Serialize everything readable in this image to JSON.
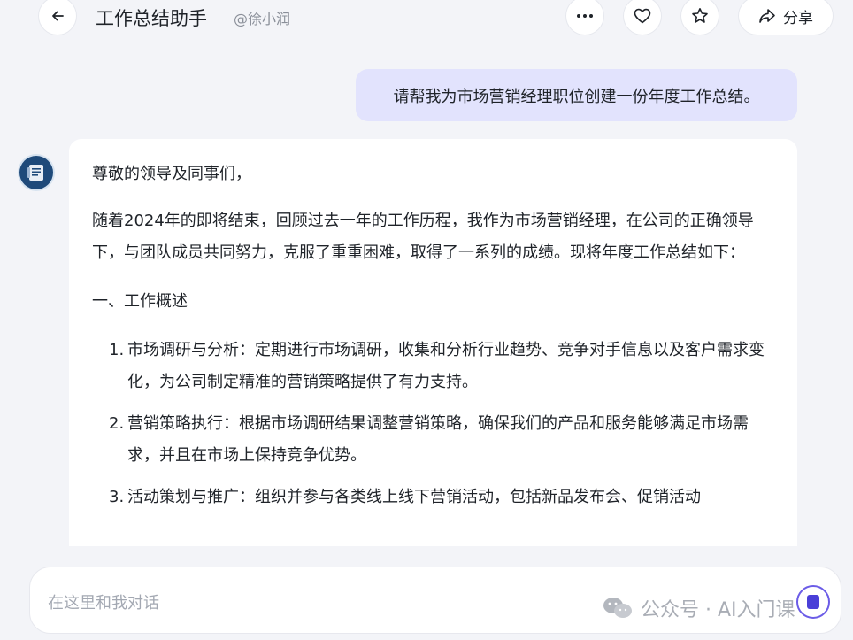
{
  "header": {
    "title": "工作总结助手",
    "author": "@徐小润",
    "share_label": "分享"
  },
  "user_message": "请帮我为市场营销经理职位创建一份年度工作总结。",
  "bot_message": {
    "greeting": "尊敬的领导及同事们，",
    "intro": "随着2024年的即将结束，回顾过去一年的工作历程，我作为市场营销经理，在公司的正确领导下，与团队成员共同努力，克服了重重困难，取得了一系列的成绩。现将年度工作总结如下：",
    "section_title": "一、工作概述",
    "items": [
      {
        "num": "1.",
        "text": "市场调研与分析：定期进行市场调研，收集和分析行业趋势、竞争对手信息以及客户需求变化，为公司制定精准的营销策略提供了有力支持。"
      },
      {
        "num": "2.",
        "text": "营销策略执行：根据市场调研结果调整营销策略，确保我们的产品和服务能够满足市场需求，并且在市场上保持竞争优势。"
      },
      {
        "num": "3.",
        "text": "活动策划与推广：组织并参与各类线上线下营销活动，包括新品发布会、促销活动"
      }
    ]
  },
  "input": {
    "placeholder": "在这里和我对话"
  },
  "watermark": "公众号 · AI入门课",
  "colors": {
    "background": "#f3f4f8",
    "user_bubble": "#e2e3fd",
    "accent": "#4a3fd8"
  },
  "icons": [
    "back-arrow-icon",
    "more-icon",
    "heart-icon",
    "star-icon",
    "share-icon",
    "bot-avatar-icon",
    "wechat-icon",
    "send-icon"
  ]
}
